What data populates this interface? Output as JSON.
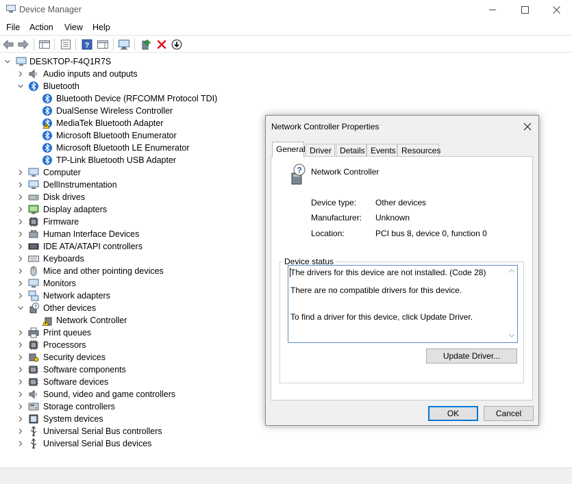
{
  "window": {
    "title": "Device Manager"
  },
  "menu": [
    "File",
    "Action",
    "View",
    "Help"
  ],
  "tree": {
    "root": "DESKTOP-F4Q1R7S",
    "items": [
      {
        "label": "Audio inputs and outputs",
        "icon": "speaker-icon"
      },
      {
        "label": "Bluetooth",
        "icon": "bluetooth-icon"
      },
      {
        "label": "Bluetooth Device (RFCOMM Protocol TDI)",
        "icon": "bluetooth-icon"
      },
      {
        "label": "DualSense Wireless Controller",
        "icon": "bluetooth-icon"
      },
      {
        "label": "MediaTek Bluetooth Adapter",
        "icon": "bluetooth-warning-icon"
      },
      {
        "label": "Microsoft Bluetooth Enumerator",
        "icon": "bluetooth-icon"
      },
      {
        "label": "Microsoft Bluetooth LE Enumerator",
        "icon": "bluetooth-icon"
      },
      {
        "label": "TP-Link Bluetooth USB Adapter",
        "icon": "bluetooth-icon"
      },
      {
        "label": "Computer",
        "icon": "computer-icon"
      },
      {
        "label": "DellInstrumentation",
        "icon": "computer-icon"
      },
      {
        "label": "Disk drives",
        "icon": "disk-icon"
      },
      {
        "label": "Display adapters",
        "icon": "display-icon"
      },
      {
        "label": "Firmware",
        "icon": "chip-icon"
      },
      {
        "label": "Human Interface Devices",
        "icon": "hid-icon"
      },
      {
        "label": "IDE ATA/ATAPI controllers",
        "icon": "ide-icon"
      },
      {
        "label": "Keyboards",
        "icon": "keyboard-icon"
      },
      {
        "label": "Mice and other pointing devices",
        "icon": "mouse-icon"
      },
      {
        "label": "Monitors",
        "icon": "monitor-icon"
      },
      {
        "label": "Network adapters",
        "icon": "network-icon"
      },
      {
        "label": "Other devices",
        "icon": "other-devices-icon"
      },
      {
        "label": "Network Controller",
        "icon": "warning-device-icon"
      },
      {
        "label": "Print queues",
        "icon": "printer-icon"
      },
      {
        "label": "Processors",
        "icon": "processor-icon"
      },
      {
        "label": "Security devices",
        "icon": "security-icon"
      },
      {
        "label": "Software components",
        "icon": "software-icon"
      },
      {
        "label": "Software devices",
        "icon": "software-icon"
      },
      {
        "label": "Sound, video and game controllers",
        "icon": "speaker-icon"
      },
      {
        "label": "Storage controllers",
        "icon": "storage-icon"
      },
      {
        "label": "System devices",
        "icon": "system-icon"
      },
      {
        "label": "Universal Serial Bus controllers",
        "icon": "usb-icon"
      },
      {
        "label": "Universal Serial Bus devices",
        "icon": "usb-icon"
      }
    ]
  },
  "dialog": {
    "title": "Network Controller Properties",
    "tabs": [
      "General",
      "Driver",
      "Details",
      "Events",
      "Resources"
    ],
    "device_name": "Network Controller",
    "props": [
      {
        "label": "Device type:",
        "value": "Other devices"
      },
      {
        "label": "Manufacturer:",
        "value": "Unknown"
      },
      {
        "label": "Location:",
        "value": "PCI bus 8, device 0, function 0"
      }
    ],
    "status_group": "Device status",
    "status_lines": [
      "The drivers for this device are not installed. (Code 28)",
      "There are no compatible drivers for this device.",
      "To find a driver for this device, click Update Driver."
    ],
    "update_button": "Update Driver...",
    "ok": "OK",
    "cancel": "Cancel"
  },
  "colors": {
    "accent": "#0078d7",
    "bluetooth": "#1f6fd1",
    "warning": "#f0c419",
    "error": "#e81123"
  }
}
